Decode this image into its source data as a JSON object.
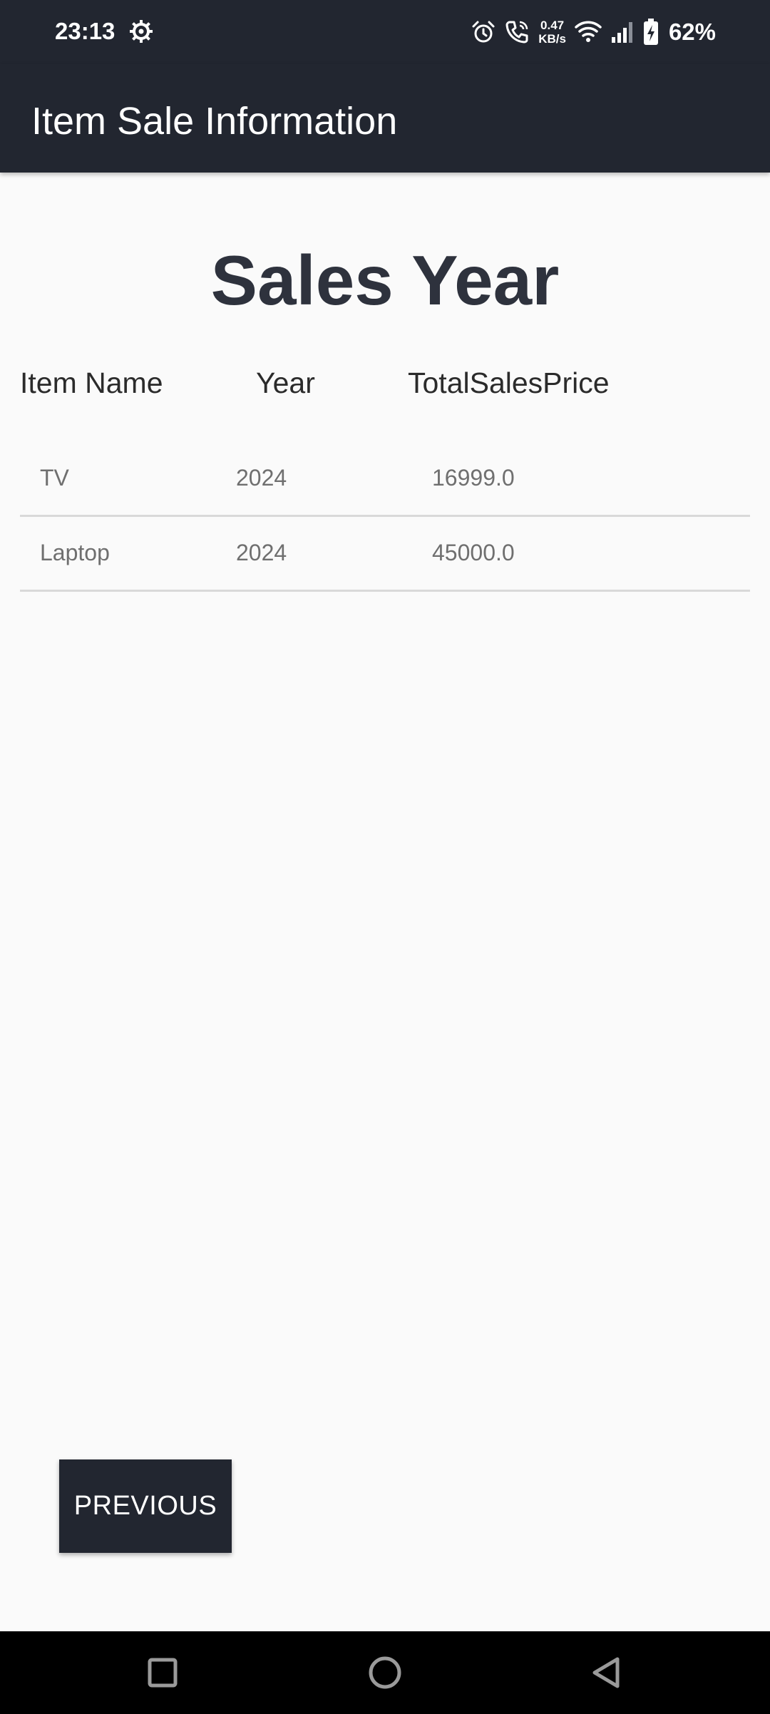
{
  "status_bar": {
    "time": "23:13",
    "net_speed_value": "0.47",
    "net_speed_unit": "KB/s",
    "battery": "62%",
    "icons": [
      "settings-icon",
      "alarm-icon",
      "call-icon",
      "wifi-icon",
      "signal-icon",
      "battery-charging-icon"
    ]
  },
  "app_bar": {
    "title": "Item Sale Information"
  },
  "main": {
    "heading": "Sales Year",
    "columns": {
      "item_name": "Item Name",
      "year": "Year",
      "total_sales_price": "TotalSalesPrice"
    },
    "rows": [
      {
        "item_name": "TV",
        "year": "2024",
        "total_sales_price": "16999.0"
      },
      {
        "item_name": "Laptop",
        "year": "2024",
        "total_sales_price": "45000.0"
      }
    ],
    "previous_label": "PREVIOUS"
  },
  "nav_bar": {
    "icons": [
      "recent-apps-icon",
      "home-icon",
      "back-icon"
    ]
  },
  "colors": {
    "app_bar": "#222630",
    "background": "#fafafa",
    "heading": "#2e323d"
  }
}
